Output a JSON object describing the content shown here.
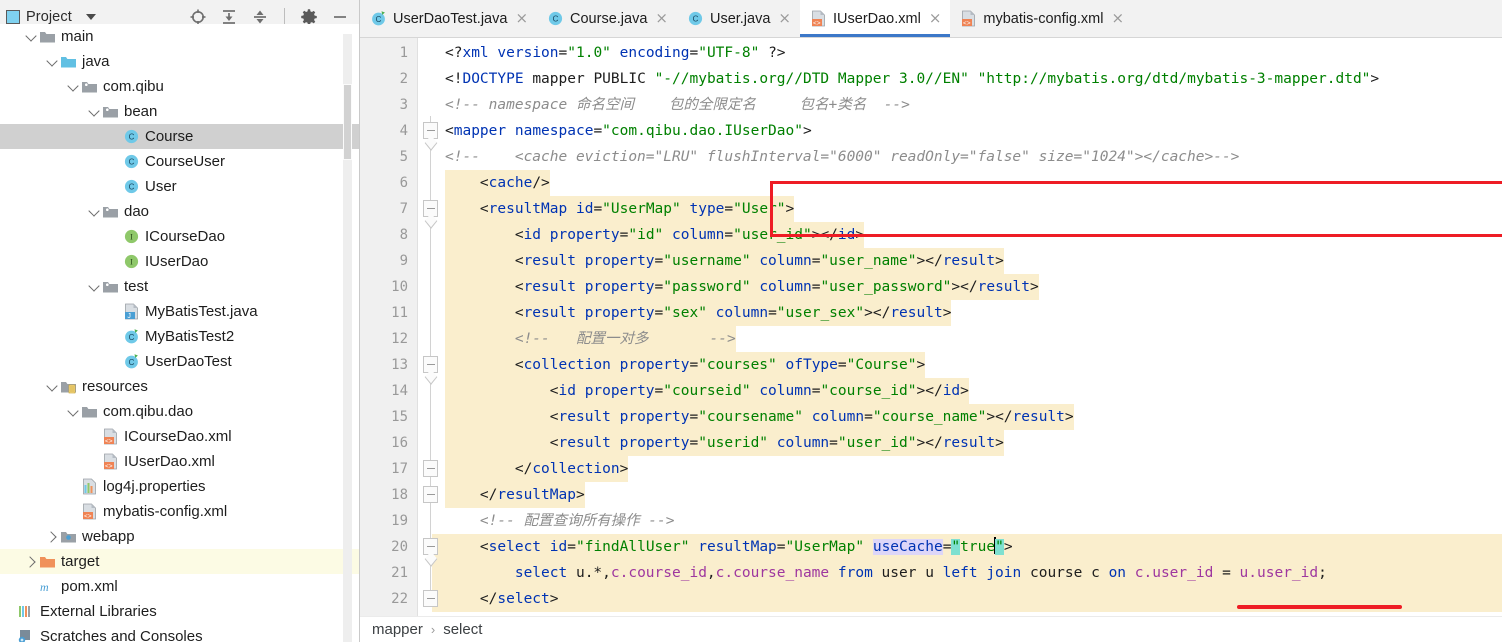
{
  "panel": {
    "title": "Project",
    "icons": [
      "project-view-icon",
      "caret-down-icon",
      "locate-icon",
      "expand-all-icon",
      "collapse-all-icon",
      "settings-gear-icon",
      "hide-icon"
    ]
  },
  "tree": {
    "items": [
      {
        "label": "main",
        "indent": 1,
        "arrow": "down",
        "icon": "folder",
        "state": "normal"
      },
      {
        "label": "java",
        "indent": 2,
        "arrow": "down",
        "icon": "folder-blue",
        "state": "normal"
      },
      {
        "label": "com.qibu",
        "indent": 3,
        "arrow": "down",
        "icon": "package",
        "state": "normal"
      },
      {
        "label": "bean",
        "indent": 4,
        "arrow": "down",
        "icon": "package",
        "state": "normal"
      },
      {
        "label": "Course",
        "indent": 5,
        "arrow": "none",
        "icon": "class",
        "state": "selected"
      },
      {
        "label": "CourseUser",
        "indent": 5,
        "arrow": "none",
        "icon": "class",
        "state": "normal"
      },
      {
        "label": "User",
        "indent": 5,
        "arrow": "none",
        "icon": "class",
        "state": "normal"
      },
      {
        "label": "dao",
        "indent": 4,
        "arrow": "down",
        "icon": "package",
        "state": "normal"
      },
      {
        "label": "ICourseDao",
        "indent": 5,
        "arrow": "none",
        "icon": "interface",
        "state": "normal"
      },
      {
        "label": "IUserDao",
        "indent": 5,
        "arrow": "none",
        "icon": "interface",
        "state": "normal"
      },
      {
        "label": "test",
        "indent": 4,
        "arrow": "down",
        "icon": "package",
        "state": "normal"
      },
      {
        "label": "MyBatisTest.java",
        "indent": 5,
        "arrow": "none",
        "icon": "javafile",
        "state": "normal"
      },
      {
        "label": "MyBatisTest2",
        "indent": 5,
        "arrow": "none",
        "icon": "class-run",
        "state": "normal"
      },
      {
        "label": "UserDaoTest",
        "indent": 5,
        "arrow": "none",
        "icon": "class-run",
        "state": "normal"
      },
      {
        "label": "resources",
        "indent": 2,
        "arrow": "down",
        "icon": "resources",
        "state": "normal"
      },
      {
        "label": "com.qibu.dao",
        "indent": 3,
        "arrow": "down",
        "icon": "folder",
        "state": "normal"
      },
      {
        "label": "ICourseDao.xml",
        "indent": 4,
        "arrow": "none",
        "icon": "xmlfile",
        "state": "normal"
      },
      {
        "label": "IUserDao.xml",
        "indent": 4,
        "arrow": "none",
        "icon": "xmlfile",
        "state": "normal"
      },
      {
        "label": "log4j.properties",
        "indent": 3,
        "arrow": "none",
        "icon": "properties",
        "state": "normal"
      },
      {
        "label": "mybatis-config.xml",
        "indent": 3,
        "arrow": "none",
        "icon": "xmlfile",
        "state": "normal"
      },
      {
        "label": "webapp",
        "indent": 2,
        "arrow": "right",
        "icon": "webapp",
        "state": "normal"
      },
      {
        "label": "target",
        "indent": 1,
        "arrow": "right",
        "icon": "folder-orange",
        "state": "highlighted"
      },
      {
        "label": "pom.xml",
        "indent": 1,
        "arrow": "none",
        "icon": "maven",
        "state": "normal"
      },
      {
        "label": "External Libraries",
        "indent": 0,
        "arrow": "none",
        "icon": "libraries",
        "state": "normal"
      },
      {
        "label": "Scratches and Consoles",
        "indent": 0,
        "arrow": "none",
        "icon": "scratches",
        "state": "normal"
      }
    ]
  },
  "tabs": [
    {
      "label": "UserDaoTest.java",
      "icon": "class-run-icon",
      "active": false,
      "close": "×"
    },
    {
      "label": "Course.java",
      "icon": "class-icon",
      "active": false,
      "close": "×"
    },
    {
      "label": "User.java",
      "icon": "class-icon",
      "active": false,
      "close": "×"
    },
    {
      "label": "IUserDao.xml",
      "icon": "xml-icon",
      "active": true,
      "close": "×"
    },
    {
      "label": "mybatis-config.xml",
      "icon": "xml-icon",
      "active": false,
      "close": "×"
    }
  ],
  "editor": {
    "lines": [
      {
        "no": "1",
        "text": "<?xml version=\"1.0\" encoding=\"UTF-8\" ?>"
      },
      {
        "no": "2",
        "text": "<!DOCTYPE mapper PUBLIC \"-//mybatis.org//DTD Mapper 3.0//EN\" \"http://mybatis.org/dtd/mybatis-3-mapper.dtd\">"
      },
      {
        "no": "3",
        "text": "<!-- namespace 命名空间    包的全限定名     包名+类名  -->"
      },
      {
        "no": "4",
        "text": "<mapper namespace=\"com.qibu.dao.IUserDao\">"
      },
      {
        "no": "5",
        "text": "<!--    <cache eviction=\"LRU\" flushInterval=\"6000\" readOnly=\"false\" size=\"1024\"></cache>-->"
      },
      {
        "no": "6",
        "text": "    <cache/>"
      },
      {
        "no": "7",
        "text": "    <resultMap id=\"UserMap\" type=\"User\">"
      },
      {
        "no": "8",
        "text": "        <id property=\"id\" column=\"user_id\"></id>"
      },
      {
        "no": "9",
        "text": "        <result property=\"username\" column=\"user_name\"></result>"
      },
      {
        "no": "10",
        "text": "        <result property=\"password\" column=\"user_password\"></result>"
      },
      {
        "no": "11",
        "text": "        <result property=\"sex\" column=\"user_sex\"></result>"
      },
      {
        "no": "12",
        "text": "        <!--   配置一对多       -->"
      },
      {
        "no": "13",
        "text": "        <collection property=\"courses\" ofType=\"Course\">"
      },
      {
        "no": "14",
        "text": "            <id property=\"courseid\" column=\"course_id\"></id>"
      },
      {
        "no": "15",
        "text": "            <result property=\"coursename\" column=\"course_name\"></result>"
      },
      {
        "no": "16",
        "text": "            <result property=\"userid\" column=\"user_id\"></result>"
      },
      {
        "no": "17",
        "text": "        </collection>"
      },
      {
        "no": "18",
        "text": "    </resultMap>"
      },
      {
        "no": "19",
        "text": "    <!-- 配置查询所有操作 -->"
      },
      {
        "no": "20",
        "text": "    <select id=\"findAllUser\" resultMap=\"UserMap\" useCache=\"true\">"
      },
      {
        "no": "21",
        "text": "        select u.*,c.course_id,c.course_name from user u left join course c on c.user_id = u.user_id;"
      },
      {
        "no": "22",
        "text": "    </select>"
      }
    ],
    "annotations": {
      "red_box_lines": "5-6",
      "red_underline_target": "useCache=\"true\"",
      "caret_after": "true",
      "identifier_highlight": "useCache",
      "search_highlight": "\"true\""
    }
  },
  "breadcrumb": {
    "items": [
      "mapper",
      "select"
    ],
    "separator": "›"
  },
  "colors": {
    "accent_blue": "#3c78c8",
    "red_marker": "#ee1c25",
    "highlight_yellow": "#faeecd",
    "tag_blue": "#0033b3",
    "value_green": "#008000",
    "comment_gray": "#8c8c8c",
    "column_purple": "#9e379f",
    "identifier_hl": "#ddd6f8",
    "search_hl": "#7ee0d0"
  }
}
